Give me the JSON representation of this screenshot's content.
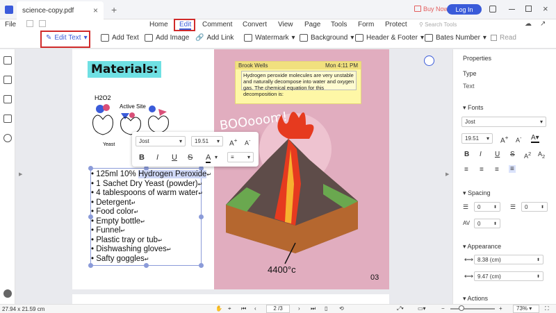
{
  "window": {
    "tab_title": "science-copy.pdf",
    "buy_now": "Buy Now",
    "login": "Log In"
  },
  "menu": {
    "file": "File",
    "items": [
      "Home",
      "Edit",
      "Comment",
      "Convert",
      "View",
      "Page",
      "Tools",
      "Form",
      "Protect"
    ],
    "search_placeholder": "Search Tools"
  },
  "toolbar": {
    "edit_text": "Edit Text",
    "add_text": "Add Text",
    "add_image": "Add Image",
    "add_link": "Add Link",
    "watermark": "Watermark",
    "background": "Background",
    "header_footer": "Header & Footer",
    "bates": "Bates Number",
    "read": "Read"
  },
  "page": {
    "title": "Materials:",
    "diagram": {
      "h2o2": "H2O2",
      "active_site": "Active Site",
      "yeast": "Yeast"
    },
    "list": [
      "125ml 10% ",
      "1 Sachet Dry Yeast (powder)",
      "4 tablespoons of warm water",
      "Detergent",
      "Food color",
      "Empty bottle",
      "Funnel",
      "Plastic tray or tub",
      "Dishwashing gloves",
      "Safty goggles"
    ],
    "list_highlight": "Hydrogen Peroxide",
    "return_mark": "↵",
    "boom": "BOOooom!",
    "temp": "4400°c",
    "page_number": "03"
  },
  "note": {
    "author": "Brook Wells",
    "time": "Mon 4:11 PM",
    "text": "Hydrogen peroxide molecules are very unstable and naturally decompose into water and oxygen gas. The chemical equation for this decomposition is:"
  },
  "floatbar": {
    "font": "Jost",
    "size": "19.51"
  },
  "properties": {
    "title": "Properties",
    "type_label": "Type",
    "type_value": "Text",
    "fonts_label": "Fonts",
    "font": "Jost",
    "size": "19.51",
    "spacing_label": "Spacing",
    "line_spacing": "0",
    "char_spacing": "0",
    "av": "0",
    "appearance_label": "Appearance",
    "width": "8.38 (cm)",
    "height": "9.47 (cm)",
    "actions_label": "Actions"
  },
  "status": {
    "dimensions": "27.94 x 21.59 cm",
    "page": "2 /3",
    "zoom": "73%"
  }
}
